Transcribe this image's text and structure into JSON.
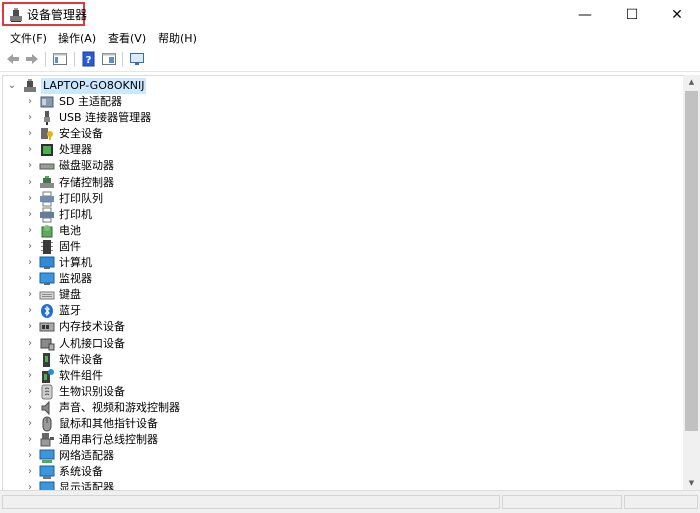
{
  "window": {
    "title": "设备管理器",
    "controls": {
      "minimize": "—",
      "maximize": "☐",
      "close": "✕"
    }
  },
  "menu": [
    "文件(F)",
    "操作(A)",
    "查看(V)",
    "帮助(H)"
  ],
  "toolbar": [
    "back-arrow-icon",
    "forward-arrow-icon",
    "properties-icon",
    "help-icon",
    "view-icon",
    "monitor-icon"
  ],
  "tree": {
    "root": {
      "label": "LAPTOP-GO8OKNIJ",
      "expander": "⌄"
    },
    "collapsed_glyph": "›",
    "items": [
      {
        "label": "SD 主适配器",
        "icon": "sd-host-adapter-icon"
      },
      {
        "label": "USB 连接器管理器",
        "icon": "usb-connector-icon"
      },
      {
        "label": "安全设备",
        "icon": "security-device-icon"
      },
      {
        "label": "处理器",
        "icon": "processor-icon"
      },
      {
        "label": "磁盘驱动器",
        "icon": "disk-drive-icon"
      },
      {
        "label": "存储控制器",
        "icon": "storage-controller-icon"
      },
      {
        "label": "打印队列",
        "icon": "print-queue-icon"
      },
      {
        "label": "打印机",
        "icon": "printer-icon"
      },
      {
        "label": "电池",
        "icon": "battery-icon"
      },
      {
        "label": "固件",
        "icon": "firmware-icon"
      },
      {
        "label": "计算机",
        "icon": "computer-icon"
      },
      {
        "label": "监视器",
        "icon": "monitor-icon"
      },
      {
        "label": "键盘",
        "icon": "keyboard-icon"
      },
      {
        "label": "蓝牙",
        "icon": "bluetooth-icon"
      },
      {
        "label": "内存技术设备",
        "icon": "memory-device-icon"
      },
      {
        "label": "人机接口设备",
        "icon": "hid-icon"
      },
      {
        "label": "软件设备",
        "icon": "software-device-icon"
      },
      {
        "label": "软件组件",
        "icon": "software-component-icon"
      },
      {
        "label": "生物识别设备",
        "icon": "biometric-icon"
      },
      {
        "label": "声音、视频和游戏控制器",
        "icon": "sound-icon"
      },
      {
        "label": "鼠标和其他指针设备",
        "icon": "mouse-icon"
      },
      {
        "label": "通用串行总线控制器",
        "icon": "usb-controller-icon"
      },
      {
        "label": "网络适配器",
        "icon": "network-adapter-icon"
      },
      {
        "label": "系统设备",
        "icon": "system-device-icon"
      },
      {
        "label": "显示适配器",
        "icon": "display-adapter-icon"
      }
    ]
  },
  "scrollbars": {
    "up": "▲",
    "down": "▼"
  },
  "colors": {
    "selection": "#cce8ff",
    "title_highlight": "#e0393e",
    "accent_blue": "#1e6fd9"
  }
}
